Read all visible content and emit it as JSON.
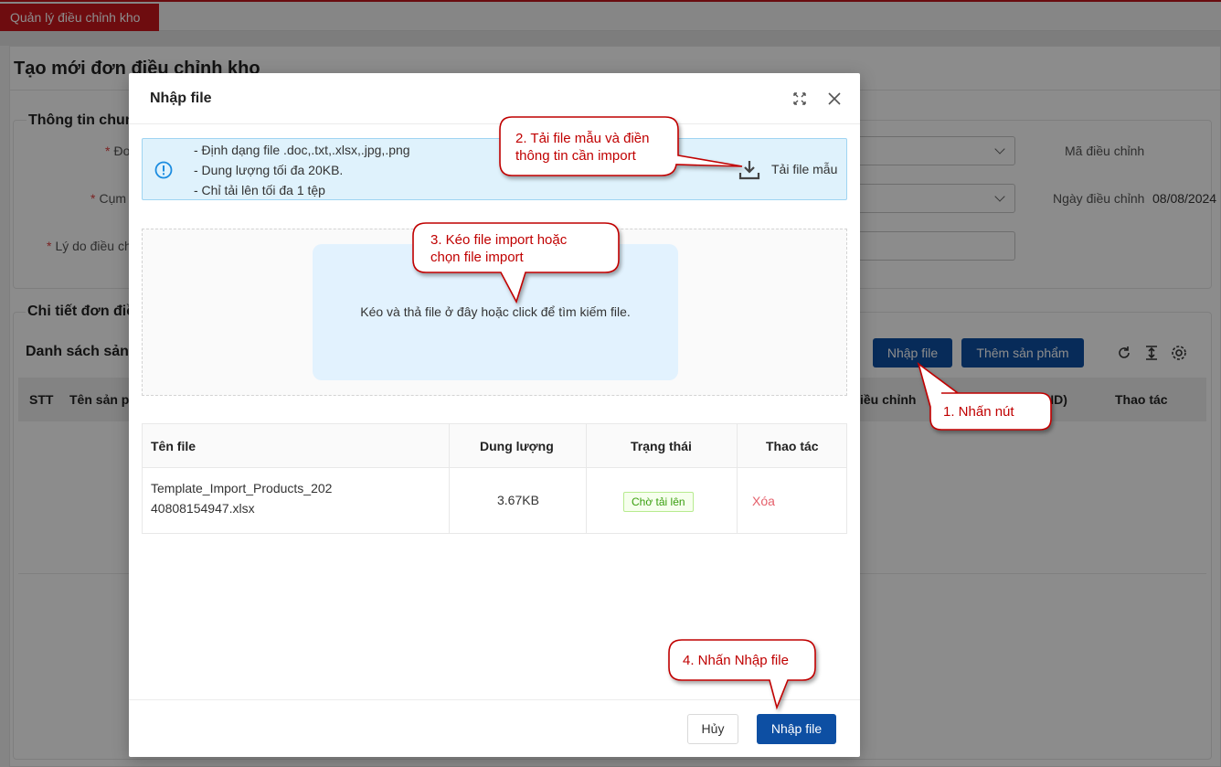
{
  "background": {
    "active_tab": "Quản lý điều chỉnh kho",
    "page_title": "Tạo mới đơn điều chỉnh kho",
    "general_section_title": "Thông tin chun",
    "field_label_1": "Đơ",
    "field_label_2": "Cụm",
    "field_label_3": "Lý do điều ch",
    "right_label_1": "Mã điều chỉnh",
    "right_label_2": "Ngày điều chỉnh",
    "date_value": "08/08/2024",
    "detail_section_title": "Chi tiết đơn điề",
    "product_list_title": "Danh sách sản",
    "import_button": "Nhập file",
    "add_product_button": "Thêm sản phẩm",
    "table_headers": {
      "stt": "STT",
      "product_name": "Tên sản p",
      "adjustment": "iều chỉnh",
      "vnd": "ND)",
      "actions": "Thao tác"
    }
  },
  "modal": {
    "title": "Nhập file",
    "info_lines": [
      "- Định dạng file .doc,.txt,.xlsx,.jpg,.png",
      "- Dung lượng tối đa 20KB.",
      "- Chỉ tải lên tối đa 1 tệp"
    ],
    "download_template": "Tải file mẫu",
    "dropzone_text": "Kéo và thả file ở đây hoặc click để tìm kiếm file.",
    "file_table": {
      "headers": [
        "Tên file",
        "Dung lượng",
        "Trạng thái",
        "Thao tác"
      ],
      "row": {
        "name_line1": "Template_Import_Products_202",
        "name_line2": "40808154947.xlsx",
        "size": "3.67KB",
        "status": "Chờ tải lên",
        "action": "Xóa"
      }
    },
    "cancel_button": "Hủy",
    "submit_button": "Nhập file"
  },
  "callouts": {
    "step1": "1. Nhấn nút",
    "step2_line1": "2. Tải file mẫu và điền",
    "step2_line2": "thông tin cần import",
    "step3_line1": "3. Kéo file import hoặc",
    "step3_line2": "chọn file import",
    "step4": "4. Nhấn Nhập file"
  },
  "colors": {
    "brand_red": "#c8161d",
    "primary_blue": "#0d4fa3",
    "callout_red": "#c00000",
    "info_bg": "#dff2fc"
  }
}
